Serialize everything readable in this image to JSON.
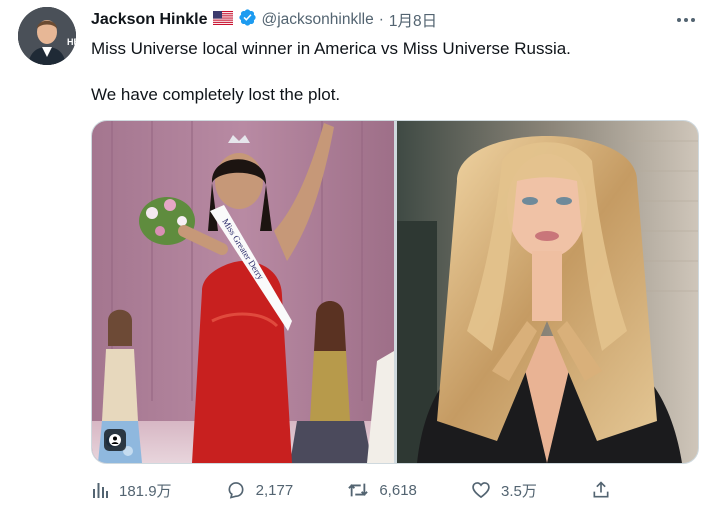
{
  "tweet": {
    "author_name": "Jackson Hinkle",
    "flag": "🇺🇸",
    "handle": "@jacksonhinklle",
    "separator": "·",
    "date": "1月8日",
    "text_line1": "Miss Universe local winner in America vs Miss Universe Russia.",
    "text_line2": "We have completely lost the plot.",
    "sash_text": "Miss Greater Derry",
    "avatar_badge": "HB"
  },
  "stats": {
    "views": "181.9万",
    "replies": "2,177",
    "retweets": "6,618",
    "likes": "3.5万"
  },
  "colors": {
    "verified": "#1d9bf0",
    "text_secondary": "#536471",
    "stage_curtain": "#b4859f",
    "red_dress": "#c8201f"
  },
  "icons": [
    "avatar",
    "flag-us-icon",
    "verified-badge-icon",
    "more-options-icon",
    "alt-text-icon",
    "views-icon",
    "reply-icon",
    "retweet-icon",
    "like-icon",
    "share-icon"
  ]
}
